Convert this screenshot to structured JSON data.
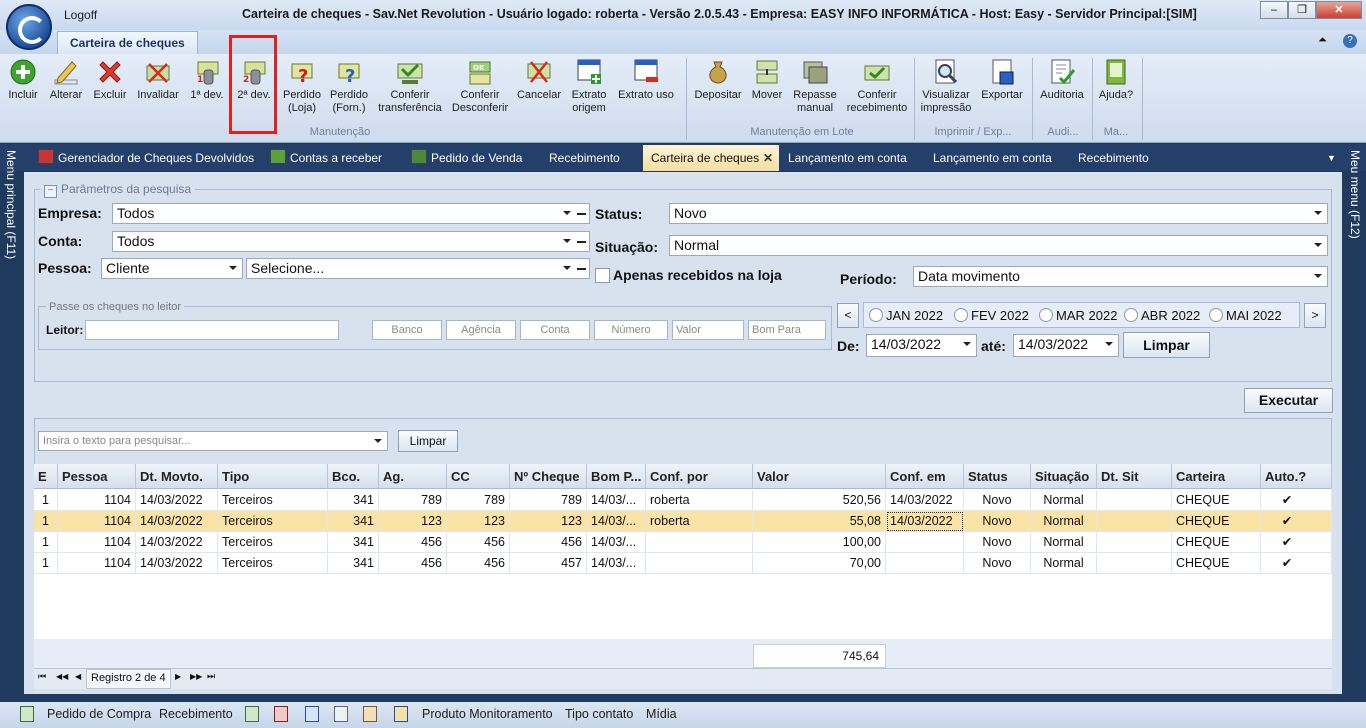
{
  "window": {
    "title": "Carteira de cheques - Sav.Net Revolution - Usuário logado: roberta - Versão 2.0.5.43 - Empresa: EASY INFO INFORMÁTICA - Host: Easy - Servidor Principal:[SIM]",
    "logoff": "Logoff",
    "minimize": "–",
    "restore": "❐",
    "close": "✕"
  },
  "ribbon": {
    "tab": "Carteira de cheques",
    "buttons": {
      "incluir": "Incluir",
      "alterar": "Alterar",
      "excluir": "Excluir",
      "invalidar": "Invalidar",
      "dev1": "1ª dev.",
      "dev2": "2ª dev.",
      "perdido_loja_1": "Perdido",
      "perdido_loja_2": "(Loja)",
      "perdido_forn_1": "Perdido",
      "perdido_forn_2": "(Forn.)",
      "conf_transf_1": "Conferir",
      "conf_transf_2": "transferência",
      "conf_desconf_1": "Conferir",
      "conf_desconf_2": "Desconferir",
      "cancelar": "Cancelar",
      "extrato_origem_1": "Extrato",
      "extrato_origem_2": "origem",
      "extrato_uso": "Extrato uso",
      "depositar": "Depositar",
      "mover": "Mover",
      "repasse_1": "Repasse",
      "repasse_2": "manual",
      "conf_receb_1": "Conferir",
      "conf_receb_2": "recebimento",
      "visualizar_1": "Visualizar",
      "visualizar_2": "impressão",
      "exportar": "Exportar",
      "auditoria": "Auditoria",
      "ajuda": "Ajuda?"
    },
    "groups": {
      "manutencao": "Manutenção",
      "manutencao_lote": "Manutenção em Lote",
      "imprimir": "Imprimir / Exp...",
      "audi": "Audi...",
      "ma": "Ma..."
    }
  },
  "doc_tabs": [
    "Gerenciador de Cheques Devolvidos",
    "Contas a receber",
    "Pedido de Venda",
    "Recebimento",
    "Carteira de cheques",
    "Lançamento em conta",
    "Lançamento em conta",
    "Recebimento"
  ],
  "side": {
    "left": "Menu principal (F11)",
    "right": "Meu menu (F12)"
  },
  "params": {
    "legend": "Parâmetros da pesquisa",
    "empresa_label": "Empresa:",
    "empresa_value": "Todos",
    "conta_label": "Conta:",
    "conta_value": "Todos",
    "pessoa_label": "Pessoa:",
    "pessoa_type": "Cliente",
    "pessoa_value": "Selecione...",
    "status_label": "Status:",
    "status_value": "Novo",
    "situacao_label": "Situação:",
    "situacao_value": "Normal",
    "apenas_label": "Apenas recebidos na loja",
    "periodo_label": "Período:",
    "periodo_value": "Data movimento",
    "leitor_legend": "Passe os cheques no leitor",
    "leitor_label": "Leitor:",
    "placeholders": [
      "Banco",
      "Agência",
      "Conta",
      "Número",
      "Valor",
      "Bom Para"
    ],
    "months": [
      "JAN 2022",
      "FEV 2022",
      "MAR 2022",
      "ABR 2022",
      "MAI 2022"
    ],
    "prev": "<",
    "next": ">",
    "de_label": "De:",
    "de_value": "14/03/2022",
    "ate_label": "até:",
    "ate_value": "14/03/2022",
    "limpar": "Limpar",
    "executar": "Executar"
  },
  "grid": {
    "search_placeholder": "Insira o texto para pesquisar...",
    "limpar": "Limpar",
    "columns": [
      "E",
      "Pessoa",
      "Dt. Movto.",
      "Tipo",
      "Bco.",
      "Ag.",
      "CC",
      "Nº Cheque",
      "Bom P...",
      "Conf. por",
      "Valor",
      "Conf. em",
      "Status",
      "Situação",
      "Dt. Sit",
      "Carteira",
      "Auto.?"
    ],
    "rows": [
      [
        "1",
        "1104",
        "14/03/2022",
        "Terceiros",
        "341",
        "789",
        "789",
        "789",
        "14/03/...",
        "roberta",
        "520,56",
        "14/03/2022",
        "Novo",
        "Normal",
        "",
        "CHEQUE",
        "✔"
      ],
      [
        "1",
        "1104",
        "14/03/2022",
        "Terceiros",
        "341",
        "123",
        "123",
        "123",
        "14/03/...",
        "roberta",
        "55,08",
        "14/03/2022",
        "Novo",
        "Normal",
        "",
        "CHEQUE",
        "✔"
      ],
      [
        "1",
        "1104",
        "14/03/2022",
        "Terceiros",
        "341",
        "456",
        "456",
        "456",
        "14/03/...",
        "",
        "100,00",
        "",
        "Novo",
        "Normal",
        "",
        "CHEQUE",
        "✔"
      ],
      [
        "1",
        "1104",
        "14/03/2022",
        "Terceiros",
        "341",
        "456",
        "456",
        "457",
        "14/03/...",
        "",
        "70,00",
        "",
        "Novo",
        "Normal",
        "",
        "CHEQUE",
        "✔"
      ]
    ],
    "selected_row": 1,
    "total": "745,64",
    "nav_text": "Registro 2 de 4",
    "nav_first": "⏮",
    "nav_prev_page": "◀◀",
    "nav_prev": "◀",
    "nav_next": "▶",
    "nav_next_page": "▶▶",
    "nav_last": "⏭"
  },
  "statusbar": {
    "pedido_compra": "Pedido de Compra",
    "recebimento": "Recebimento",
    "produto_monit": "Produto Monitoramento",
    "tipo_contato": "Tipo contato",
    "midia": "Mídia"
  },
  "colors": {
    "accent": "#24406a",
    "selected_row": "#fbe3a6",
    "highlight": "#e12020"
  }
}
